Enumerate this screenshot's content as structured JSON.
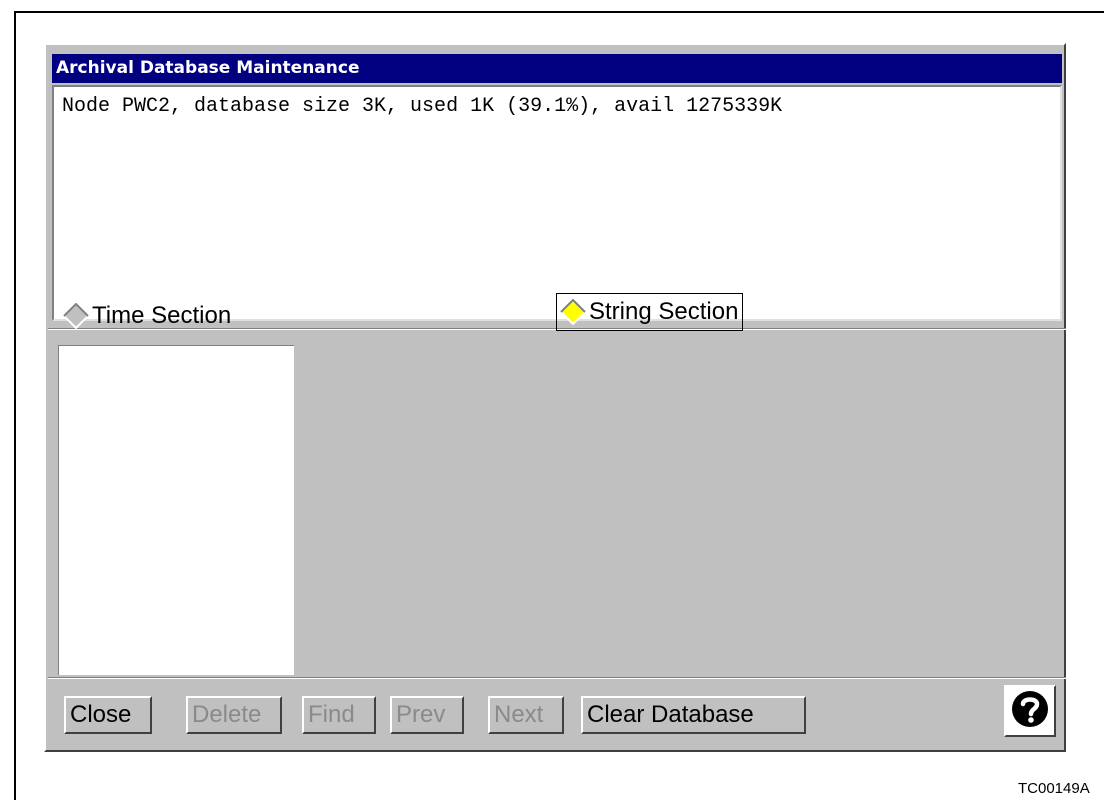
{
  "window": {
    "title": "Archival Database Maintenance"
  },
  "status": {
    "text": "Node PWC2, database size 3K, used 1K (39.1%), avail 1275339K"
  },
  "sections": {
    "time": {
      "label": "Time Section",
      "selected": false
    },
    "string": {
      "label": "String Section",
      "selected": true
    }
  },
  "toolbar": {
    "close": "Close",
    "delete": "Delete",
    "find": "Find",
    "prev": "Prev",
    "next": "Next",
    "clear_database": "Clear Database"
  },
  "figure_code": "TC00149A",
  "icons": {
    "help": "help-icon"
  },
  "colors": {
    "titlebar": "#000080",
    "selected_radio": "#ffff00",
    "window_bg": "#c0c0c0"
  }
}
